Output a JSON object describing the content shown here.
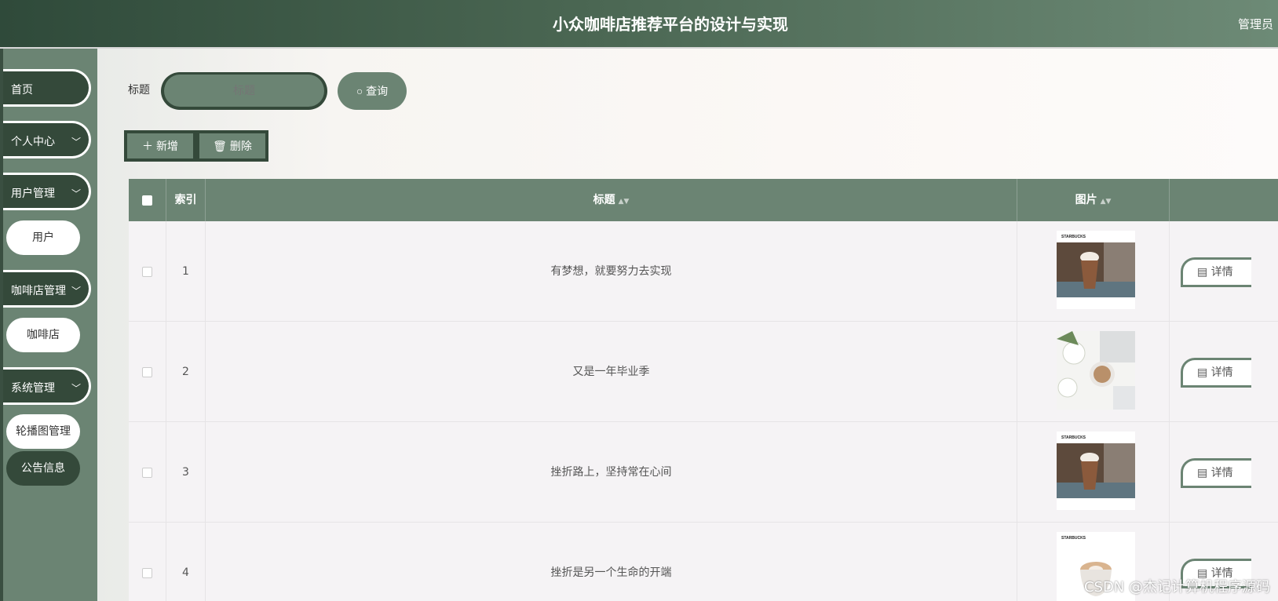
{
  "header": {
    "title": "小众咖啡店推荐平台的设计与实现",
    "role": "管理员"
  },
  "sidebar": {
    "items": [
      {
        "label": "首页",
        "has_children": false
      },
      {
        "label": "个人中心",
        "has_children": true
      },
      {
        "label": "用户管理",
        "has_children": true,
        "sub": "用户"
      },
      {
        "label": "咖啡店管理",
        "has_children": true,
        "sub": "咖啡店"
      },
      {
        "label": "系统管理",
        "has_children": true,
        "sub": "轮播图管理",
        "sub2": "公告信息"
      }
    ]
  },
  "search": {
    "label": "标题",
    "placeholder": "标题",
    "button_label": "查询"
  },
  "actions": {
    "add_label": "新增",
    "delete_label": "删除"
  },
  "table": {
    "columns": [
      "索引",
      "标题",
      "图片"
    ],
    "rows": [
      {
        "index": "1",
        "title": "有梦想，就要努力去实现",
        "image": "starbucks-frappuccino",
        "detail": "详情"
      },
      {
        "index": "2",
        "title": "又是一年毕业季",
        "image": "coffee-flowers-keyboard",
        "detail": "详情"
      },
      {
        "index": "3",
        "title": "挫折路上，坚持常在心间",
        "image": "starbucks-frappuccino",
        "detail": "详情"
      },
      {
        "index": "4",
        "title": "挫折是另一个生命的开端",
        "image": "starbucks-latte-art",
        "detail": "详情"
      }
    ]
  },
  "watermark": "CSDN @杰记计算机程序源码",
  "colors": {
    "primary": "#6b8473",
    "dark": "#34493a"
  }
}
